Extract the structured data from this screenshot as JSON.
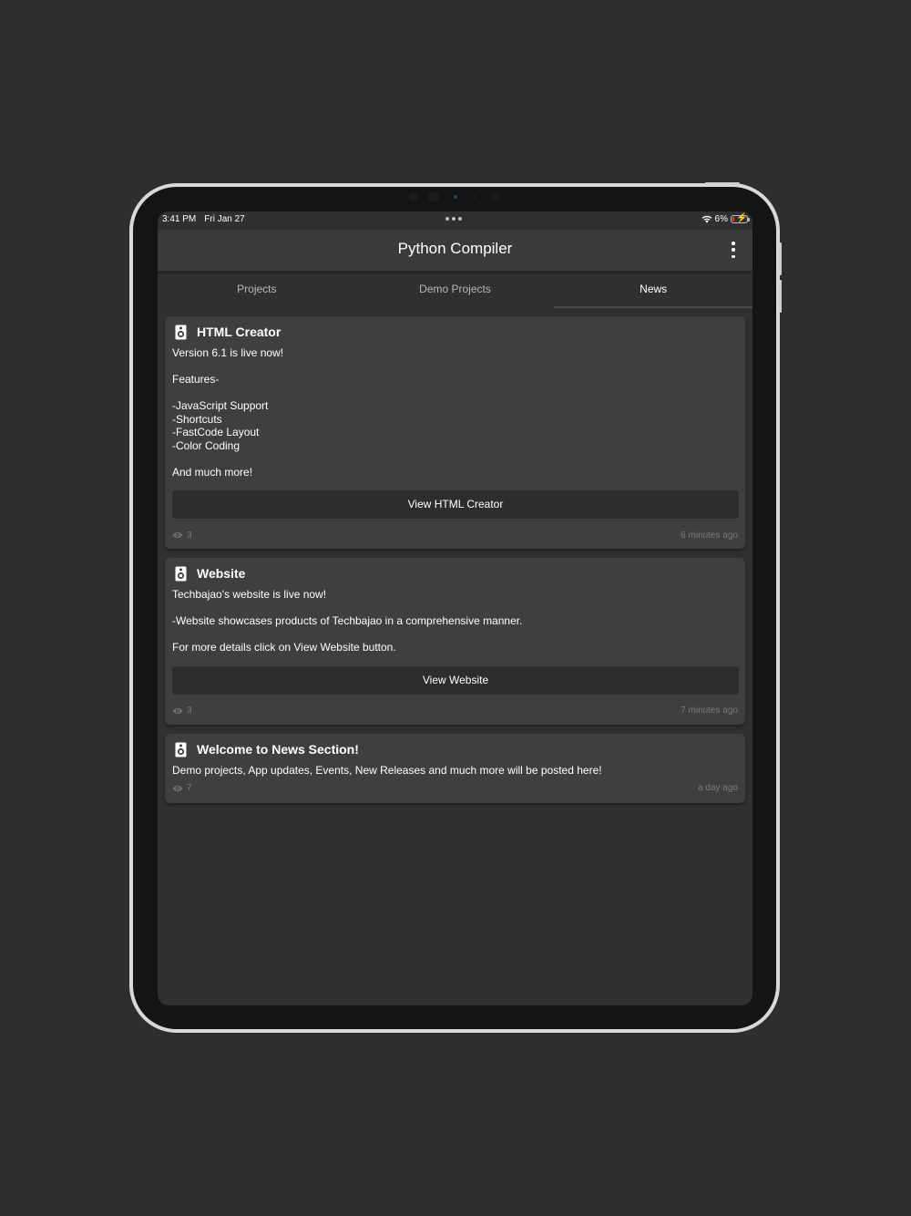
{
  "status_bar": {
    "time": "3:41 PM",
    "date": "Fri Jan 27",
    "battery": "6%",
    "wifi_icon": "wifi-icon",
    "battery_icon": "battery-charging-icon"
  },
  "app_bar": {
    "title": "Python Compiler",
    "menu_icon": "more-vertical-icon"
  },
  "tabs": [
    {
      "label": "Projects",
      "active": false
    },
    {
      "label": "Demo Projects",
      "active": false
    },
    {
      "label": "News",
      "active": true
    }
  ],
  "news": [
    {
      "icon": "speaker-icon",
      "title": "HTML Creator",
      "body": "Version 6.1 is live now!\n\nFeatures-\n\n-JavaScript Support\n-Shortcuts\n-FastCode Layout\n-Color Coding\n\nAnd much more!",
      "button_label": "View HTML Creator",
      "views": "3",
      "time": "6 minutes ago"
    },
    {
      "icon": "speaker-icon",
      "title": "Website",
      "body": "Techbajao's website is live now!\n\n-Website showcases products of Techbajao in a comprehensive manner.\n\nFor more details click on View Website button.",
      "button_label": "View Website",
      "views": "3",
      "time": "7 minutes ago"
    },
    {
      "icon": "speaker-icon",
      "title": "Welcome to News Section!",
      "body": "Demo projects, App updates, Events, New Releases and much more will be posted here!",
      "views": "7",
      "time": "a day ago"
    }
  ],
  "colors": {
    "background": "#2e2e2e",
    "screen": "#303030",
    "app_bar": "#3a3a3a",
    "card": "#3f3f3f",
    "button": "#2d2d2d",
    "muted_text": "#7a7a7a"
  }
}
